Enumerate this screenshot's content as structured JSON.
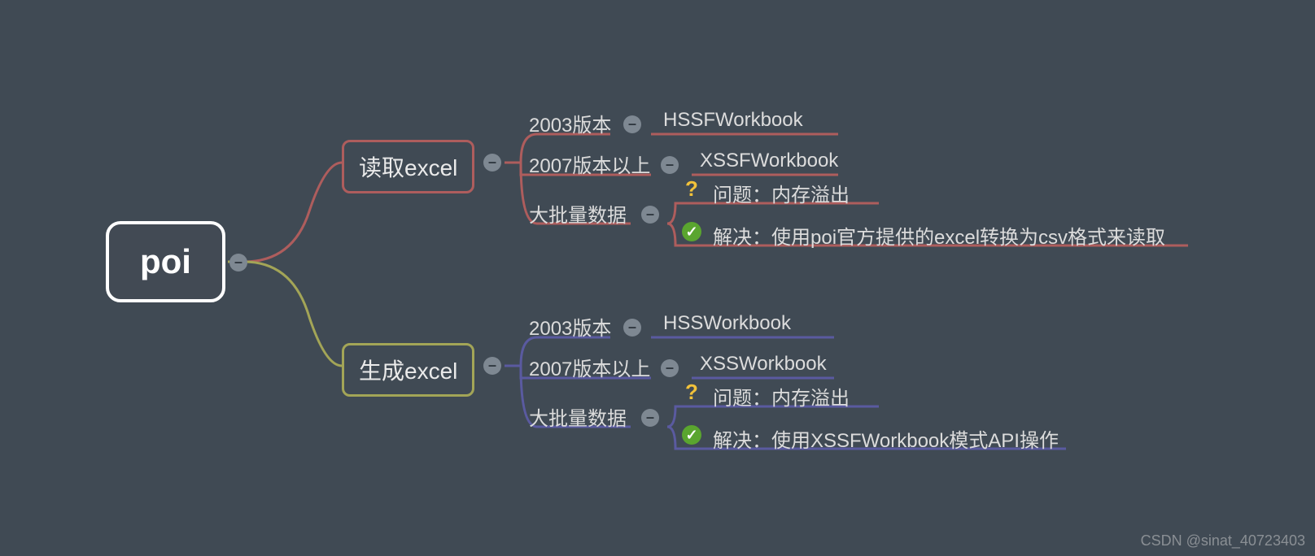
{
  "root": {
    "label": "poi"
  },
  "branches": {
    "read": {
      "label": "读取excel",
      "v2003": {
        "label": "2003版本",
        "workbook": "HSSFWorkbook"
      },
      "v2007": {
        "label": "2007版本以上",
        "workbook": "XSSFWorkbook"
      },
      "bulk": {
        "label": "大批量数据",
        "problem": "问题：内存溢出",
        "solution": "解决：使用poi官方提供的excel转换为csv格式来读取"
      }
    },
    "write": {
      "label": "生成excel",
      "v2003": {
        "label": "2003版本",
        "workbook": "HSSWorkbook"
      },
      "v2007": {
        "label": "2007版本以上",
        "workbook": "XSSWorkbook"
      },
      "bulk": {
        "label": "大批量数据",
        "problem": "问题：内存溢出",
        "solution": "解决：使用XSSFWorkbook模式API操作"
      }
    }
  },
  "watermark": "CSDN @sinat_40723403",
  "colors": {
    "bg": "#404a54",
    "red": "#ae5d5d",
    "olive": "#a3a557",
    "purple": "#5a5aa0",
    "minus": "#7e8892",
    "question": "#f2c23a",
    "check": "#5aa52f"
  }
}
